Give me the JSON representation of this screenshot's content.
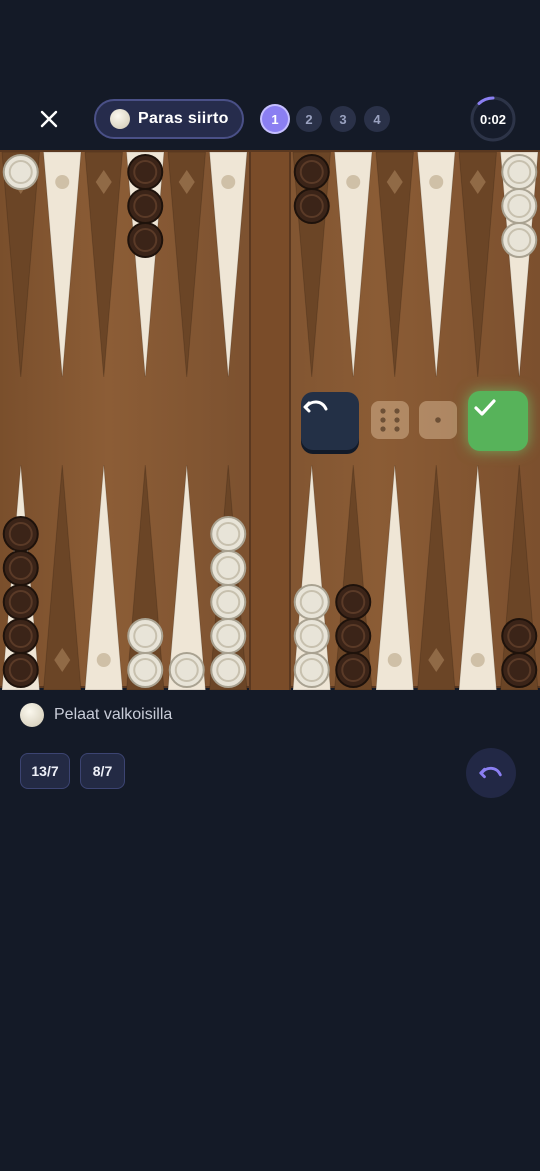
{
  "header": {
    "close_icon": "close-icon",
    "best_move_label": "Paras siirto",
    "steps": [
      "1",
      "2",
      "3",
      "4"
    ],
    "active_step": 1,
    "timer": "0:02",
    "timer_icon": "progress-ring"
  },
  "board": {
    "white_checker_color": "#e8e4d8",
    "dark_checker_color": "#3b2418",
    "points": {
      "top_left": [
        {
          "color": "white",
          "count": 1
        },
        {
          "color": "none",
          "count": 0
        },
        {
          "color": "none",
          "count": 0
        },
        {
          "color": "dark",
          "count": 3
        },
        {
          "color": "none",
          "count": 0
        },
        {
          "color": "none",
          "count": 0
        }
      ],
      "top_right": [
        {
          "color": "dark",
          "count": 2
        },
        {
          "color": "none",
          "count": 0
        },
        {
          "color": "none",
          "count": 0
        },
        {
          "color": "none",
          "count": 0
        },
        {
          "color": "none",
          "count": 0
        },
        {
          "color": "white",
          "count": 3
        }
      ],
      "bottom_left": [
        {
          "color": "dark",
          "count": 5
        },
        {
          "color": "none",
          "count": 0
        },
        {
          "color": "none",
          "count": 0
        },
        {
          "color": "white",
          "count": 2
        },
        {
          "color": "white",
          "count": 1
        },
        {
          "color": "white",
          "count": 5
        }
      ],
      "bottom_right": [
        {
          "color": "white",
          "count": 3
        },
        {
          "color": "dark",
          "count": 3
        },
        {
          "color": "none",
          "count": 0
        },
        {
          "color": "none",
          "count": 0
        },
        {
          "color": "none",
          "count": 0
        },
        {
          "color": "dark",
          "count": 2
        }
      ]
    },
    "dice": [
      6,
      1
    ],
    "undo_icon": "undo-icon",
    "confirm_icon": "check-icon"
  },
  "info": {
    "player_text": "Pelaat valkoisilla"
  },
  "moves": [
    "13/7",
    "8/7"
  ],
  "colors": {
    "background": "#141a27",
    "accent": "#8b7ff2",
    "confirm_green": "#57b35a"
  }
}
